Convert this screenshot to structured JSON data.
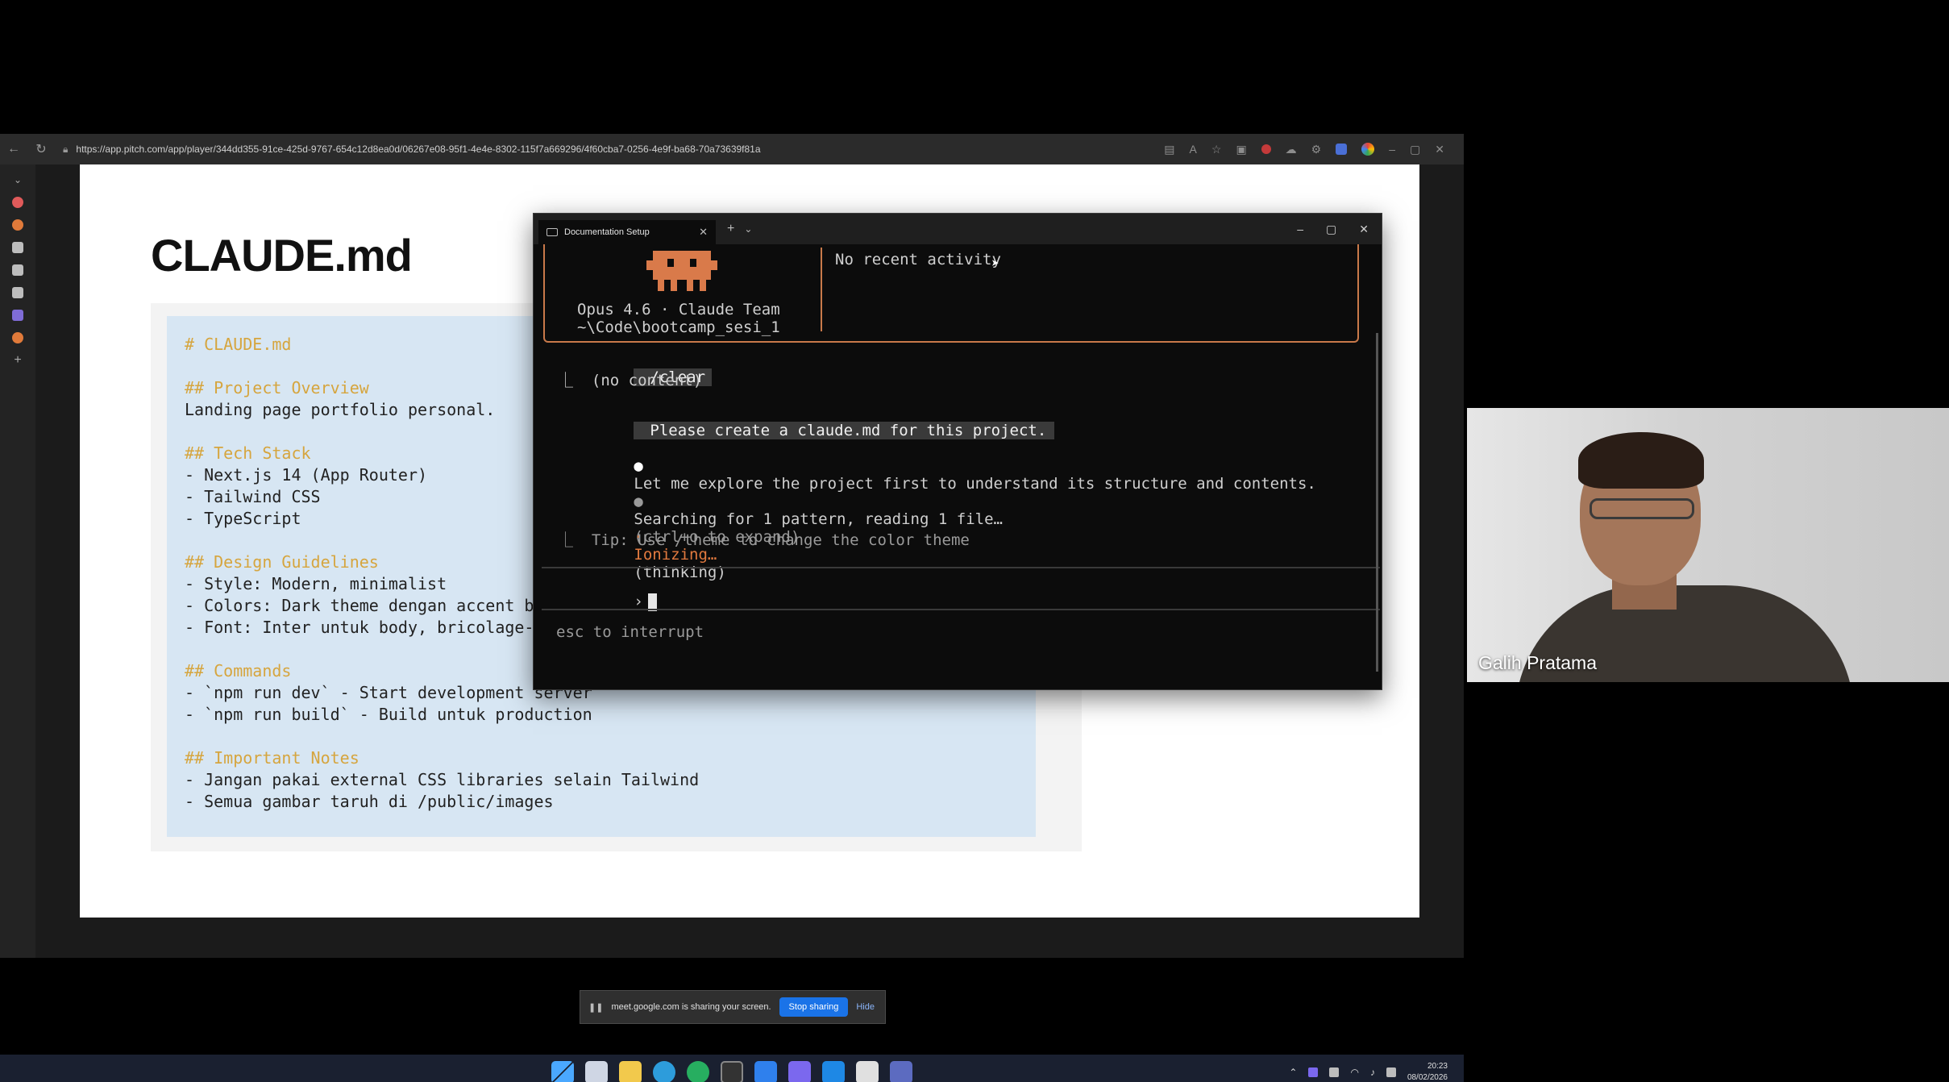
{
  "browser": {
    "url": "https://app.pitch.com/app/player/344dd355-91ce-425d-9767-654c12d8ea0d/06267e08-95f1-4e4e-8302-115f7a669296/4f60cba7-0256-4e9f-ba68-70a73639f81a",
    "back_icon": "arrow-left-icon",
    "reload_icon": "reload-icon"
  },
  "slide": {
    "title": "CLAUDE.md",
    "code_lines": [
      {
        "text": "# CLAUDE.md",
        "heading": true
      },
      {
        "text": "",
        "heading": false
      },
      {
        "text": "## Project Overview",
        "heading": true
      },
      {
        "text": "Landing page portfolio personal.",
        "heading": false
      },
      {
        "text": "",
        "heading": false
      },
      {
        "text": "## Tech Stack",
        "heading": true
      },
      {
        "text": "- Next.js 14 (App Router)",
        "heading": false
      },
      {
        "text": "- Tailwind CSS",
        "heading": false
      },
      {
        "text": "- TypeScript",
        "heading": false
      },
      {
        "text": "",
        "heading": false
      },
      {
        "text": "## Design Guidelines",
        "heading": true
      },
      {
        "text": "- Style: Modern, minimalist",
        "heading": false
      },
      {
        "text": "- Colors: Dark theme dengan accent b",
        "heading": false
      },
      {
        "text": "- Font: Inter untuk body, bricolage-",
        "heading": false
      },
      {
        "text": "",
        "heading": false
      },
      {
        "text": "## Commands",
        "heading": true
      },
      {
        "text": "- `npm run dev` - Start development server",
        "heading": false
      },
      {
        "text": "- `npm run build` - Build untuk production",
        "heading": false
      },
      {
        "text": "",
        "heading": false
      },
      {
        "text": "## Important Notes",
        "heading": true
      },
      {
        "text": "- Jangan pakai external CSS libraries selain Tailwind",
        "heading": false
      },
      {
        "text": "- Semua gambar taruh di /public/images",
        "heading": false
      }
    ]
  },
  "terminal": {
    "tab_title": "Documentation Setup",
    "tab_close": "✕",
    "new_tab": "+",
    "dropdown": "⌄",
    "controls": {
      "minimize": "–",
      "maximize": "▢",
      "close": "✕"
    },
    "banner": {
      "model_line": "Opus 4.6 · Claude Team",
      "path_line": "~\\Code\\bootcamp_sesi_1",
      "activity": "No recent activity"
    },
    "command": "/clear",
    "command_result": "⎿  (no content)",
    "user_prompt": "Please create a claude.md for this project.",
    "assistant_line": "Let me explore the project first to understand its structure and contents.",
    "search_line": "Searching for 1 pattern, reading 1 file…",
    "search_hint": "(ctrl+o to expand)",
    "status_word": "Ionizing…",
    "status_paren": "(thinking)",
    "tip": "⎿  Tip: Use /theme to change the color theme",
    "prompt_symbol": "›",
    "interrupt_hint": "esc to interrupt"
  },
  "share_bar": {
    "message": "meet.google.com is sharing your screen.",
    "stop_label": "Stop sharing",
    "hide_label": "Hide"
  },
  "taskbar": {
    "clock_time": "20:23",
    "clock_date": "08/02/2026"
  },
  "webcam": {
    "participant_name": "Galih Pratama"
  }
}
